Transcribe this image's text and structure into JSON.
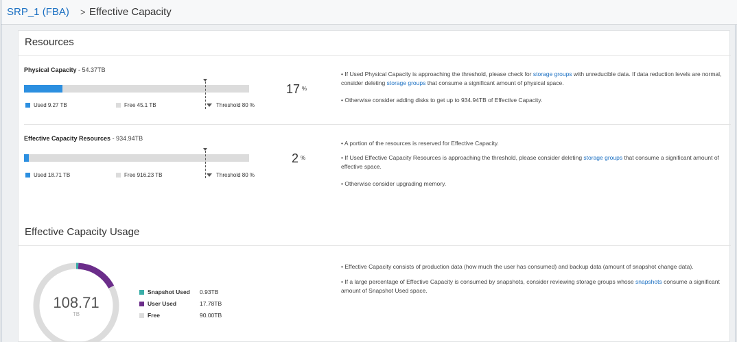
{
  "breadcrumb": {
    "parent": "SRP_1 (FBA)",
    "separator": ">",
    "current": "Effective Capacity"
  },
  "resources": {
    "title": "Resources",
    "physical": {
      "label": "Physical Capacity",
      "total": " - 54.37TB",
      "percent": "17",
      "percent_unit": "%",
      "used_fraction": 0.17,
      "threshold_fraction": 0.8,
      "legend": {
        "used": "Used 9.27 TB",
        "free": "Free 45.1 TB",
        "threshold": "Threshold 80 %"
      },
      "notes": [
        {
          "parts": [
            "• If Used Physical Capacity is approaching the threshold, please check for ",
            "storage groups",
            " with unreducible data. If data reduction levels are normal, consider deleting ",
            "storage groups",
            " that consume a significant amount of physical space."
          ]
        },
        {
          "text": "• Otherwise consider adding disks to get up to 934.94TB of Effective Capacity."
        }
      ]
    },
    "effective": {
      "label": "Effective Capacity Resources",
      "total": " - 934.94TB",
      "percent": "2",
      "percent_unit": "%",
      "used_fraction": 0.02,
      "threshold_fraction": 0.8,
      "legend": {
        "used": "Used 18.71 TB",
        "free": "Free 916.23 TB",
        "threshold": "Threshold 80 %"
      },
      "notes": [
        {
          "text": "• A portion of the resources is reserved for Effective Capacity."
        },
        {
          "parts": [
            "• If Used Effective Capacity Resources is approaching the threshold, please consider deleting ",
            "storage groups",
            " that consume a significant amount of effective space."
          ]
        },
        {
          "text": "• Otherwise consider upgrading memory."
        }
      ]
    }
  },
  "usage": {
    "title": "Effective Capacity Usage",
    "center_value": "108.71",
    "center_unit": "TB",
    "legend": [
      {
        "label": "Snapshot Used",
        "value": "0.93TB",
        "color": "#3aaea8",
        "amount": 0.93
      },
      {
        "label": "User Used",
        "value": "17.78TB",
        "color": "#6b2d8a",
        "amount": 17.78
      },
      {
        "label": "Free",
        "value": "90.00TB",
        "color": "#dcdcdc",
        "amount": 90.0
      }
    ],
    "notes": [
      {
        "text": "• Effective Capacity consists of production data (how much the user has consumed) and backup data (amount of snapshot change data)."
      },
      {
        "parts": [
          "• If a large percentage of Effective Capacity is consumed by snapshots, consider reviewing storage groups whose ",
          "snapshots",
          " consume a significant amount of Snapshot Used space."
        ]
      }
    ]
  },
  "colors": {
    "used": "#2c8fe0",
    "free": "#dcdcdc",
    "link": "#1a6fc2"
  }
}
